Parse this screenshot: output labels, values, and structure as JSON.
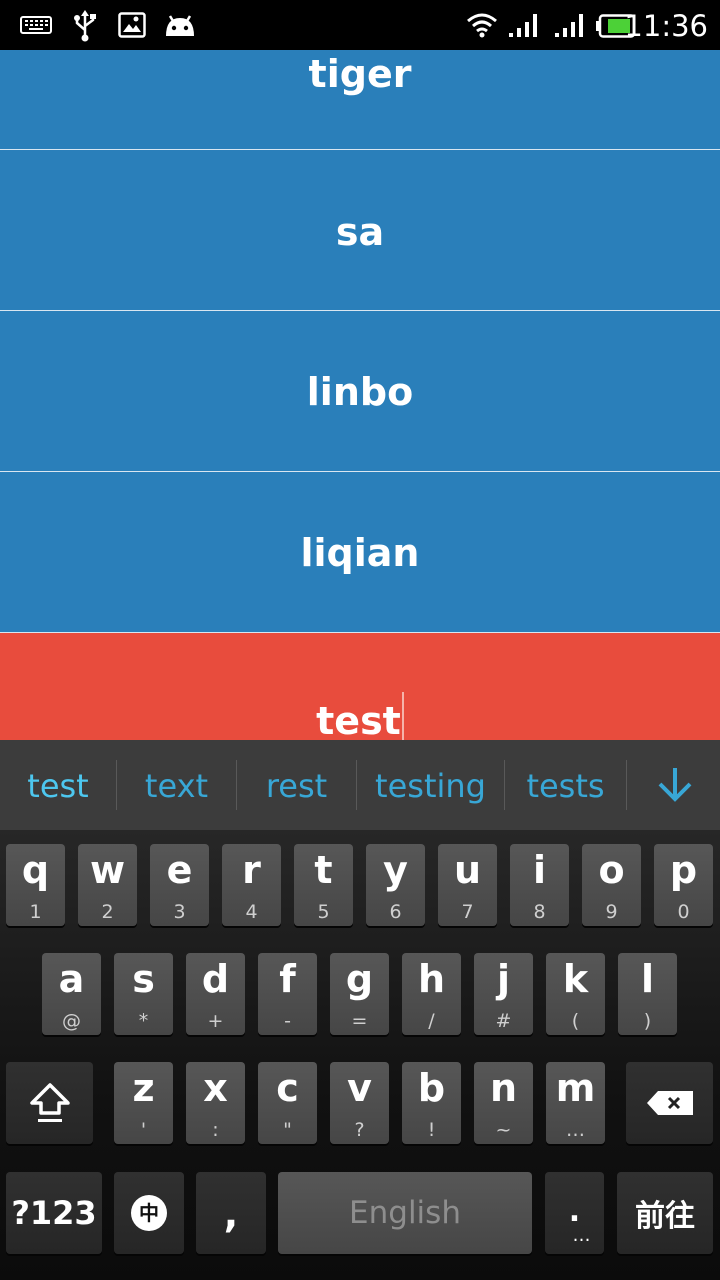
{
  "status_bar": {
    "icons": [
      "keyboard-icon",
      "usb-icon",
      "image-icon",
      "android-icon",
      "wifi-icon",
      "signal-icon",
      "signal-icon-2",
      "battery-icon"
    ],
    "time": "11:36"
  },
  "list": {
    "items": [
      "tiger",
      "sa",
      "linbo",
      "liqian"
    ],
    "editing_text": "test"
  },
  "suggestions": [
    "test",
    "text",
    "rest",
    "testing",
    "tests"
  ],
  "keyboard": {
    "row1": [
      [
        "q",
        "1"
      ],
      [
        "w",
        "2"
      ],
      [
        "e",
        "3"
      ],
      [
        "r",
        "4"
      ],
      [
        "t",
        "5"
      ],
      [
        "y",
        "6"
      ],
      [
        "u",
        "7"
      ],
      [
        "i",
        "8"
      ],
      [
        "o",
        "9"
      ],
      [
        "p",
        "0"
      ]
    ],
    "row2": [
      [
        "a",
        "@"
      ],
      [
        "s",
        "*"
      ],
      [
        "d",
        "+"
      ],
      [
        "f",
        "-"
      ],
      [
        "g",
        "="
      ],
      [
        "h",
        "/"
      ],
      [
        "j",
        "#"
      ],
      [
        "k",
        "("
      ],
      [
        "l",
        ")"
      ]
    ],
    "row3": [
      [
        "z",
        "'"
      ],
      [
        "x",
        ":"
      ],
      [
        "c",
        "\""
      ],
      [
        "v",
        "?"
      ],
      [
        "b",
        "!"
      ],
      [
        "n",
        "~"
      ],
      [
        "m",
        "…"
      ]
    ],
    "symbols_label": "?123",
    "ime_label": "中",
    "comma_label": ",",
    "space_label": "English",
    "period_label": ".",
    "period_sub": "…",
    "go_label": "前往"
  }
}
